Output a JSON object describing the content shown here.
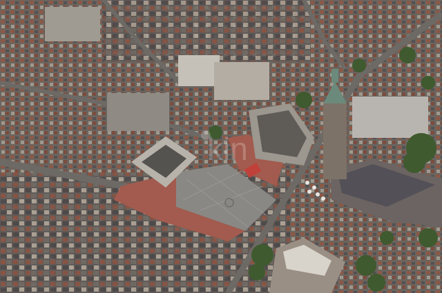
{
  "photo": {
    "subject": "aerial-view-city-square-church-tower",
    "watermark_text": "kin"
  },
  "palette": {
    "roof_red": "#9a5a46",
    "roof_dark": "#4a4a4c",
    "square": "#8a8884",
    "square_red": "#a25b4e",
    "tree": "#3f5a2e",
    "street": "#6d6a66"
  }
}
